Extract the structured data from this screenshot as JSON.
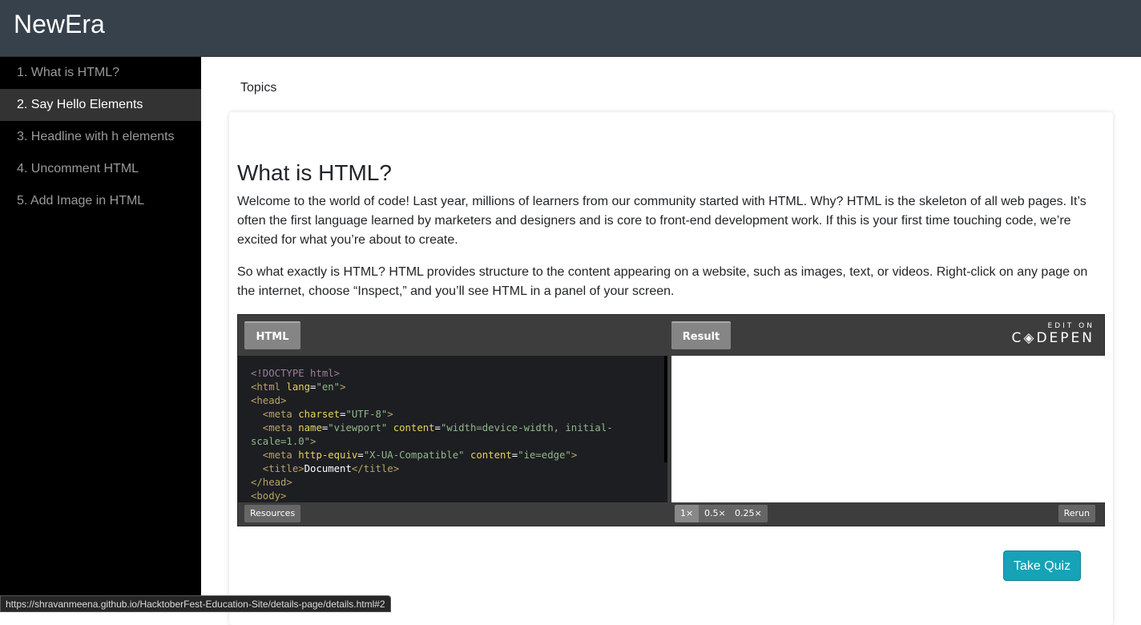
{
  "header": {
    "brand": "NewEra"
  },
  "sidebar": {
    "items": [
      {
        "label": "1. What is HTML?"
      },
      {
        "label": "2. Say Hello Elements",
        "active": true
      },
      {
        "label": "3. Headline with h elements"
      },
      {
        "label": "4. Uncomment HTML"
      },
      {
        "label": "5. Add Image in HTML"
      }
    ]
  },
  "main": {
    "topics": "Topics",
    "title": "What is HTML?",
    "para1": "Welcome to the world of code! Last year, millions of learners from our community started with HTML. Why? HTML is the skeleton of all web pages. It’s often the first language learned by marketers and designers and is core to front-end development work. If this is your first time touching code, we’re excited for what you’re about to create.",
    "para2": "So what exactly is HTML? HTML provides structure to the content appearing on a website, such as images, text, or videos. Right-click on any page on the internet, choose “Inspect,” and you’ll see HTML in a panel of your screen.",
    "quiz_label": "Take Quiz"
  },
  "codepen": {
    "html_tab": "HTML",
    "result_tab": "Result",
    "edit_on": "EDIT ON",
    "brand": "C◈DEPEN",
    "resources": "Resources",
    "zoom_1x": "1×",
    "zoom_05x": "0.5×",
    "zoom_025x": "0.25×",
    "rerun": "Rerun",
    "code_lines": [
      [
        [
          "d",
          "<!DOCTYPE html>"
        ]
      ],
      [
        [
          "t",
          "<html "
        ],
        [
          "a",
          "lang"
        ],
        [
          "w",
          "="
        ],
        [
          "s",
          "\"en\""
        ],
        [
          "t",
          ">"
        ]
      ],
      [
        [
          "t",
          "<head>"
        ]
      ],
      [
        [
          "t",
          "  <meta "
        ],
        [
          "a",
          "charset"
        ],
        [
          "w",
          "="
        ],
        [
          "s",
          "\"UTF-8\""
        ],
        [
          "t",
          ">"
        ]
      ],
      [
        [
          "t",
          "  <meta "
        ],
        [
          "a",
          "name"
        ],
        [
          "w",
          "="
        ],
        [
          "s",
          "\"viewport\" "
        ],
        [
          "a",
          "content"
        ],
        [
          "w",
          "="
        ],
        [
          "s",
          "\"width=device-width, initial-"
        ]
      ],
      [
        [
          "s",
          "scale=1.0\""
        ],
        [
          "t",
          ">"
        ]
      ],
      [
        [
          "t",
          "  <meta "
        ],
        [
          "a",
          "http-equiv"
        ],
        [
          "w",
          "="
        ],
        [
          "s",
          "\"X-UA-Compatible\" "
        ],
        [
          "a",
          "content"
        ],
        [
          "w",
          "="
        ],
        [
          "s",
          "\"ie=edge\""
        ],
        [
          "t",
          ">"
        ]
      ],
      [
        [
          "t",
          "  <title>"
        ],
        [
          "w",
          "Document"
        ],
        [
          "t",
          "</title>"
        ]
      ],
      [
        [
          "t",
          "</head>"
        ]
      ],
      [
        [
          "t",
          "<body>"
        ]
      ]
    ]
  },
  "status_bar": {
    "url": "https://shravanmeena.github.io/HacktoberFest-Education-Site/details-page/details.html#2"
  }
}
